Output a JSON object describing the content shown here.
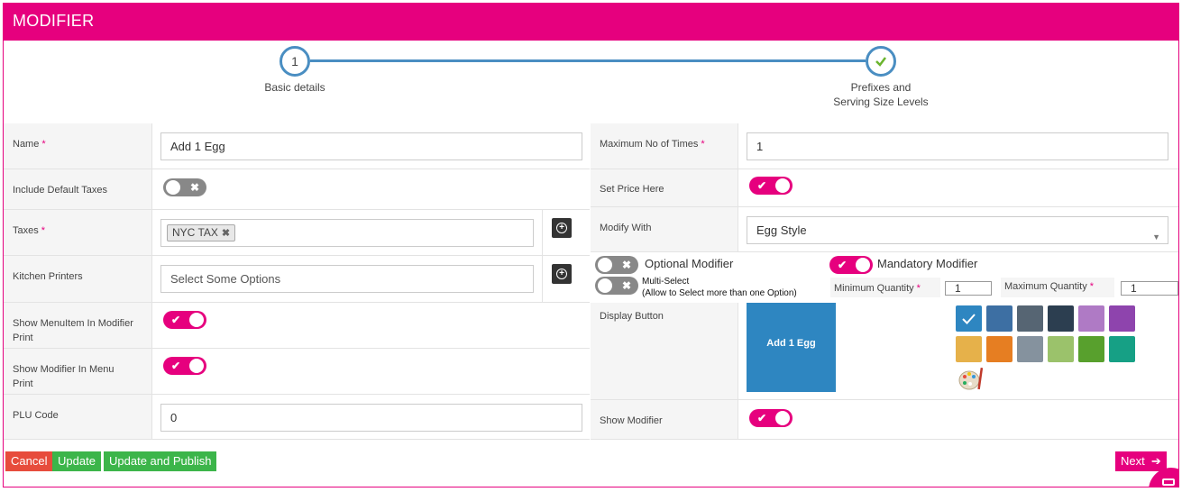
{
  "header": {
    "title": "MODIFIER"
  },
  "stepper": {
    "step1": {
      "number": "1",
      "label": "Basic details"
    },
    "step2": {
      "icon": "check-icon",
      "label_line1": "Prefixes and",
      "label_line2": "Serving Size Levels"
    }
  },
  "left": {
    "name": {
      "label": "Name",
      "value": "Add 1 Egg"
    },
    "include_default_taxes": {
      "label": "Include Default Taxes",
      "state": "off"
    },
    "taxes": {
      "label": "Taxes",
      "chip": "NYC TAX"
    },
    "kitchen_printers": {
      "label": "Kitchen Printers",
      "placeholder": "Select Some Options"
    },
    "show_menuitem": {
      "label_line1": "Show MenuItem In Modifier",
      "label_line2": "Print",
      "state": "on"
    },
    "show_modifier_menu": {
      "label_line1": "Show Modifier In Menu",
      "label_line2": "Print",
      "state": "on"
    },
    "plu_code": {
      "label": "PLU Code",
      "value": "0"
    }
  },
  "right": {
    "max_times": {
      "label": "Maximum No of Times",
      "value": "1"
    },
    "set_price": {
      "label": "Set Price Here",
      "state": "on"
    },
    "modify_with": {
      "label": "Modify With",
      "value": "Egg Style"
    },
    "optional_modifier": {
      "label": "Optional Modifier",
      "state": "off"
    },
    "mandatory_modifier": {
      "label": "Mandatory Modifier",
      "state": "on"
    },
    "multi_select": {
      "label": "Multi-Select",
      "sublabel": "(Allow to Select more than one Option)",
      "state": "off"
    },
    "min_qty": {
      "label": "Minimum Quantity",
      "value": "1"
    },
    "max_qty": {
      "label": "Maximum Quantity",
      "value": "1"
    },
    "display_button": {
      "label": "Display Button",
      "preview_text": "Add 1 Egg",
      "preview_color": "#2e86c1"
    },
    "swatches": [
      "#2e86c1",
      "#3d6fa3",
      "#566573",
      "#2c3e50",
      "#af7ac5",
      "#8e44ad",
      "#e6b14a",
      "#e67e22",
      "#85929e",
      "#9bc26b",
      "#58a02d",
      "#16a085"
    ],
    "show_modifier": {
      "label": "Show Modifier",
      "state": "on"
    }
  },
  "actions": {
    "cancel": "Cancel",
    "update": "Update",
    "update_publish": "Update and Publish",
    "next": "Next"
  },
  "colors": {
    "brand": "#e6007e",
    "cancel": "#e74c3c",
    "success": "#3cb54a"
  }
}
